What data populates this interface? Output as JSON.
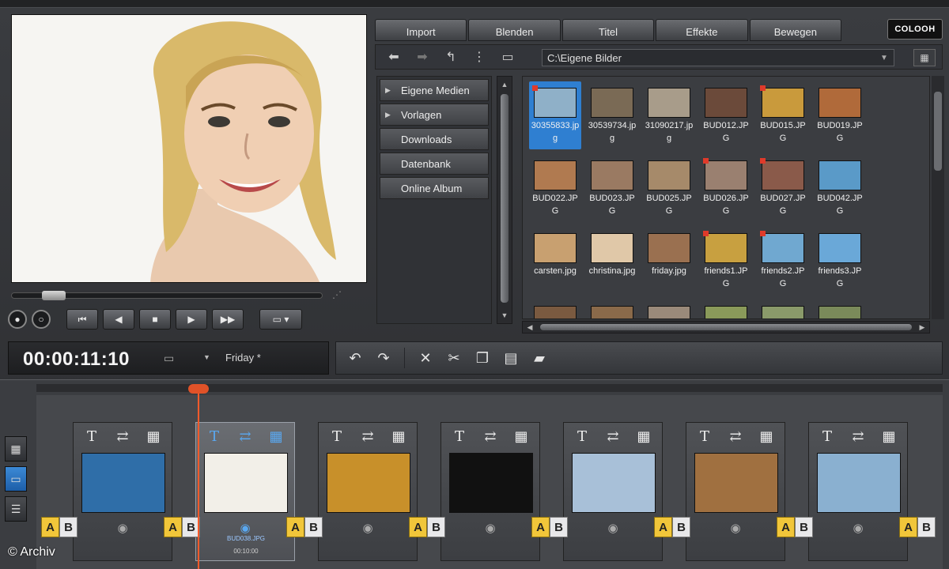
{
  "tabs": [
    "Import",
    "Blenden",
    "Titel",
    "Effekte",
    "Bewegen"
  ],
  "brand": "COLOOH",
  "path": {
    "value": "C:\\Eigene Bilder"
  },
  "sidebar": {
    "items": [
      {
        "label": "Eigene Medien",
        "has_arrow": true
      },
      {
        "label": "Vorlagen",
        "has_arrow": true
      },
      {
        "label": "Downloads",
        "has_arrow": false
      },
      {
        "label": "Datenbank",
        "has_arrow": false
      },
      {
        "label": "Online Album",
        "has_arrow": false
      }
    ]
  },
  "files": [
    {
      "name": "30355833.jpg",
      "selected": true,
      "marked": true,
      "color": "#8fb0c8"
    },
    {
      "name": "30539734.jpg",
      "selected": false,
      "marked": false,
      "color": "#7a6a55"
    },
    {
      "name": "31090217.jpg",
      "selected": false,
      "marked": false,
      "color": "#a89c8a"
    },
    {
      "name": "BUD012.JPG",
      "selected": false,
      "marked": false,
      "color": "#6b4a3a"
    },
    {
      "name": "BUD015.JPG",
      "selected": false,
      "marked": true,
      "color": "#c99a3c"
    },
    {
      "name": "BUD019.JPG",
      "selected": false,
      "marked": false,
      "color": "#b06a3a"
    },
    {
      "name": "BUD022.JPG",
      "selected": false,
      "marked": false,
      "color": "#b07a50"
    },
    {
      "name": "BUD023.JPG",
      "selected": false,
      "marked": false,
      "color": "#9a7a62"
    },
    {
      "name": "BUD025.JPG",
      "selected": false,
      "marked": false,
      "color": "#a68a6a"
    },
    {
      "name": "BUD026.JPG",
      "selected": false,
      "marked": true,
      "color": "#9a8070"
    },
    {
      "name": "BUD027.JPG",
      "selected": false,
      "marked": true,
      "color": "#8a5a4a"
    },
    {
      "name": "BUD042.JPG",
      "selected": false,
      "marked": false,
      "color": "#5a9ac8"
    },
    {
      "name": "carsten.jpg",
      "selected": false,
      "marked": false,
      "color": "#c8a070"
    },
    {
      "name": "christina.jpg",
      "selected": false,
      "marked": false,
      "color": "#e0c8a8"
    },
    {
      "name": "friday.jpg",
      "selected": false,
      "marked": false,
      "color": "#9a7050"
    },
    {
      "name": "friends1.JPG",
      "selected": false,
      "marked": true,
      "color": "#c8a040"
    },
    {
      "name": "friends2.JPG",
      "selected": false,
      "marked": true,
      "color": "#70a8d0"
    },
    {
      "name": "friends3.JPG",
      "selected": false,
      "marked": false,
      "color": "#6aa8d8"
    },
    {
      "name": "",
      "selected": false,
      "marked": false,
      "color": "#7a5a40"
    },
    {
      "name": "",
      "selected": false,
      "marked": false,
      "color": "#8a6a4a"
    },
    {
      "name": "",
      "selected": false,
      "marked": false,
      "color": "#9a8a7a"
    },
    {
      "name": "",
      "selected": false,
      "marked": false,
      "color": "#8a9a5a"
    },
    {
      "name": "",
      "selected": false,
      "marked": false,
      "color": "#8a9a6a"
    },
    {
      "name": "",
      "selected": false,
      "marked": false,
      "color": "#7a8a5a"
    }
  ],
  "timecode": "00:00:11:10",
  "project": "Friday *",
  "timeline": {
    "slots": [
      {
        "active": false,
        "name": "",
        "duration": "",
        "color": "#2f6ea8"
      },
      {
        "active": true,
        "name": "BUD038.JPG",
        "duration": "00:10:00",
        "color": "#f2efe8"
      },
      {
        "active": false,
        "name": "",
        "duration": "",
        "color": "#c8902a"
      },
      {
        "active": false,
        "name": "",
        "duration": "",
        "color": "#111111"
      },
      {
        "active": false,
        "name": "",
        "duration": "",
        "color": "#a8c0d8"
      },
      {
        "active": false,
        "name": "",
        "duration": "",
        "color": "#a07040"
      },
      {
        "active": false,
        "name": "",
        "duration": "",
        "color": "#8ab0d0"
      }
    ],
    "transition": {
      "a": "A",
      "b": "B"
    }
  },
  "credit": "© Archiv",
  "icons": {
    "title": "T",
    "swap": "⇄",
    "fx": "▦",
    "camera": "◉"
  }
}
